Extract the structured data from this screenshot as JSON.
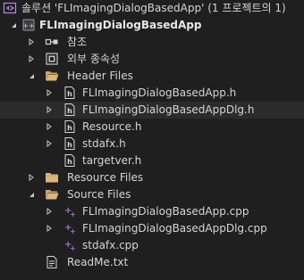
{
  "solution": {
    "label": "솔루션 'FLImagingDialogBasedApp' (1 프로젝트의 1)"
  },
  "project": {
    "label": "FLImagingDialogBasedApp"
  },
  "references": {
    "label": "참조"
  },
  "external_deps": {
    "label": "외부 종속성"
  },
  "header_files": {
    "label": "Header Files",
    "items": [
      {
        "label": "FLImagingDialogBasedApp.h"
      },
      {
        "label": "FLImagingDialogBasedAppDlg.h"
      },
      {
        "label": "Resource.h"
      },
      {
        "label": "stdafx.h"
      },
      {
        "label": "targetver.h"
      }
    ]
  },
  "resource_files": {
    "label": "Resource Files"
  },
  "source_files": {
    "label": "Source Files",
    "items": [
      {
        "label": "FLImagingDialogBasedApp.cpp"
      },
      {
        "label": "FLImagingDialogBasedAppDlg.cpp"
      },
      {
        "label": "stdafx.cpp"
      }
    ]
  },
  "readme": {
    "label": "ReadMe.txt"
  },
  "colors": {
    "background": "#1f1f1f",
    "selected_row": "#2b2b2b",
    "folder": "#dcb67a",
    "cpp_plus": "#a074c4",
    "text": "#d4d4d4"
  }
}
